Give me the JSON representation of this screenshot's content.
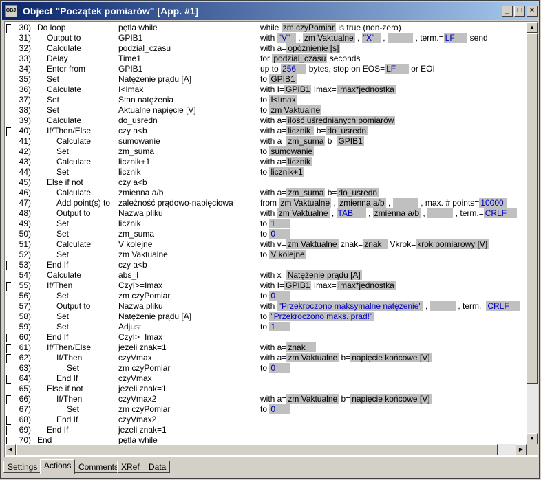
{
  "window": {
    "title": "Object \"Początek pomiarów\" [App. #1]",
    "icon_label": "OBJ",
    "buttons": {
      "minimize": "_",
      "maximize": "□",
      "close": "×"
    }
  },
  "tabs": [
    {
      "label": "Settings",
      "active": false
    },
    {
      "label": "Actions",
      "active": true
    },
    {
      "label": "Comments",
      "active": false
    },
    {
      "label": "XRef",
      "active": false
    },
    {
      "label": "Data",
      "active": false
    }
  ],
  "rows": [
    {
      "n": "30)",
      "ind": 0,
      "cmd": "Do loop",
      "arg": "pętla while",
      "br": "open",
      "p": [
        [
          "t",
          "while "
        ],
        [
          "h",
          "zm czyPomiar"
        ],
        [
          "t",
          " is true (non-zero)"
        ]
      ]
    },
    {
      "n": "31)",
      "ind": 1,
      "cmd": "Output to",
      "arg": "GPIB1",
      "p": [
        [
          "t",
          "with "
        ],
        [
          "b",
          "\"V\"  "
        ],
        [
          "t",
          " , "
        ],
        [
          "h",
          "zm Vaktualne"
        ],
        [
          "t",
          " , "
        ],
        [
          "b",
          "\"X\"  "
        ],
        [
          "t",
          " , "
        ],
        [
          "h",
          "          "
        ],
        [
          "t",
          " , term.="
        ],
        [
          "b",
          "LF     "
        ],
        [
          "t",
          " send"
        ]
      ]
    },
    {
      "n": "32)",
      "ind": 1,
      "cmd": "Calculate",
      "arg": "podzial_czasu",
      "p": [
        [
          "t",
          "with a="
        ],
        [
          "h",
          "opóźnienie [s]"
        ]
      ]
    },
    {
      "n": "33)",
      "ind": 1,
      "cmd": "Delay",
      "arg": "Time1",
      "p": [
        [
          "t",
          "for "
        ],
        [
          "h",
          "podzial_czasu"
        ],
        [
          "t",
          " seconds"
        ]
      ]
    },
    {
      "n": "34)",
      "ind": 1,
      "cmd": "Enter from",
      "arg": "GPIB1",
      "p": [
        [
          "t",
          "up to "
        ],
        [
          "b",
          "256    "
        ],
        [
          "t",
          " bytes, stop on EOS="
        ],
        [
          "b",
          "LF     "
        ],
        [
          "t",
          " or EOI"
        ]
      ]
    },
    {
      "n": "35)",
      "ind": 1,
      "cmd": "Set",
      "arg": "Natężenie prądu [A]",
      "p": [
        [
          "t",
          "to "
        ],
        [
          "h",
          "GPIB1"
        ]
      ]
    },
    {
      "n": "36)",
      "ind": 1,
      "cmd": "Calculate",
      "arg": "I<Imax",
      "p": [
        [
          "t",
          "with I="
        ],
        [
          "h",
          "GPIB1"
        ],
        [
          "t",
          " Imax="
        ],
        [
          "h",
          "Imax*jednostka"
        ]
      ]
    },
    {
      "n": "37)",
      "ind": 1,
      "cmd": "Set",
      "arg": "Stan natężenia",
      "p": [
        [
          "t",
          "to "
        ],
        [
          "h",
          "I<Imax"
        ]
      ]
    },
    {
      "n": "38)",
      "ind": 1,
      "cmd": "Set",
      "arg": "Aktualne napięcie [V]",
      "p": [
        [
          "t",
          "to "
        ],
        [
          "h",
          "zm Vaktualne"
        ]
      ]
    },
    {
      "n": "39)",
      "ind": 1,
      "cmd": "Calculate",
      "arg": "do_usredn",
      "p": [
        [
          "t",
          "with a="
        ],
        [
          "h",
          "ilość uśrednianych pomiarów"
        ]
      ]
    },
    {
      "n": "40)",
      "ind": 1,
      "cmd": "If/Then/Else",
      "arg": "czy a<b",
      "br": "open",
      "p": [
        [
          "t",
          "with a="
        ],
        [
          "h",
          "licznik "
        ],
        [
          "t",
          " b="
        ],
        [
          "h",
          "do_usredn"
        ]
      ]
    },
    {
      "n": "41)",
      "ind": 2,
      "cmd": "Calculate",
      "arg": "sumowanie",
      "p": [
        [
          "t",
          "with a="
        ],
        [
          "h",
          "zm_suma"
        ],
        [
          "t",
          " b="
        ],
        [
          "h",
          "GPIB1"
        ]
      ]
    },
    {
      "n": "42)",
      "ind": 2,
      "cmd": "Set",
      "arg": "zm_suma",
      "p": [
        [
          "t",
          "to "
        ],
        [
          "h",
          "sumowanie"
        ]
      ]
    },
    {
      "n": "43)",
      "ind": 2,
      "cmd": "Calculate",
      "arg": "licznik+1",
      "p": [
        [
          "t",
          "with a="
        ],
        [
          "h",
          "licznik"
        ]
      ]
    },
    {
      "n": "44)",
      "ind": 2,
      "cmd": "Set",
      "arg": "licznik",
      "p": [
        [
          "t",
          "to "
        ],
        [
          "h",
          "licznik+1"
        ]
      ]
    },
    {
      "n": "45)",
      "ind": 1,
      "cmd": "Else if not",
      "arg": "czy a<b",
      "p": []
    },
    {
      "n": "46)",
      "ind": 2,
      "cmd": "Calculate",
      "arg": "zmienna a/b",
      "p": [
        [
          "t",
          "with a="
        ],
        [
          "h",
          "zm_suma"
        ],
        [
          "t",
          " b="
        ],
        [
          "h",
          "do_usredn"
        ]
      ]
    },
    {
      "n": "47)",
      "ind": 2,
      "cmd": "Add point(s) to",
      "arg": "zależność prądowo-napięciowa",
      "p": [
        [
          "t",
          "from "
        ],
        [
          "h",
          "zm Vaktualne"
        ],
        [
          "t",
          " , "
        ],
        [
          "h",
          "zmienna a/b"
        ],
        [
          "t",
          " , "
        ],
        [
          "h",
          "          "
        ],
        [
          "t",
          " , max. # points="
        ],
        [
          "b",
          "10000 "
        ]
      ]
    },
    {
      "n": "48)",
      "ind": 2,
      "cmd": "Output to",
      "arg": "Nazwa pliku",
      "p": [
        [
          "t",
          "with "
        ],
        [
          "h",
          "zm Vaktualne"
        ],
        [
          "t",
          " , "
        ],
        [
          "b",
          "TAB     "
        ],
        [
          "t",
          " , "
        ],
        [
          "h",
          "zmienna a/b"
        ],
        [
          "t",
          " , "
        ],
        [
          "h",
          "          "
        ],
        [
          "t",
          " , term.="
        ],
        [
          "b",
          "CRLF    "
        ]
      ]
    },
    {
      "n": "49)",
      "ind": 2,
      "cmd": "Set",
      "arg": "licznik",
      "p": [
        [
          "t",
          "to "
        ],
        [
          "b",
          "1      "
        ]
      ]
    },
    {
      "n": "50)",
      "ind": 2,
      "cmd": "Set",
      "arg": "zm_suma",
      "p": [
        [
          "t",
          "to "
        ],
        [
          "b",
          "0      "
        ]
      ]
    },
    {
      "n": "51)",
      "ind": 2,
      "cmd": "Calculate",
      "arg": "V kolejne",
      "p": [
        [
          "t",
          "with v="
        ],
        [
          "h",
          "zm Vaktualne"
        ],
        [
          "t",
          " znak="
        ],
        [
          "h",
          "znak  "
        ],
        [
          "t",
          " Vkrok="
        ],
        [
          "h",
          "krok pomiarowy [V]"
        ]
      ]
    },
    {
      "n": "52)",
      "ind": 2,
      "cmd": "Set",
      "arg": "zm Vaktualne",
      "p": [
        [
          "t",
          "to "
        ],
        [
          "h",
          "V kolejne"
        ]
      ]
    },
    {
      "n": "53)",
      "ind": 1,
      "cmd": "End If",
      "arg": "czy a<b",
      "br": "close",
      "p": []
    },
    {
      "n": "54)",
      "ind": 1,
      "cmd": "Calculate",
      "arg": "abs_I",
      "p": [
        [
          "t",
          "with x="
        ],
        [
          "h",
          "Natężenie prądu [A]"
        ]
      ]
    },
    {
      "n": "55)",
      "ind": 1,
      "cmd": "If/Then",
      "arg": "CzyI>=Imax",
      "br": "open",
      "p": [
        [
          "t",
          "with I="
        ],
        [
          "h",
          "GPIB1"
        ],
        [
          "t",
          " Imax="
        ],
        [
          "h",
          "Imax*jednostka"
        ]
      ]
    },
    {
      "n": "56)",
      "ind": 2,
      "cmd": "Set",
      "arg": "zm czyPomiar",
      "p": [
        [
          "t",
          "to "
        ],
        [
          "b",
          "0      "
        ]
      ]
    },
    {
      "n": "57)",
      "ind": 2,
      "cmd": "Output to",
      "arg": "Nazwa pliku",
      "p": [
        [
          "t",
          "with "
        ],
        [
          "b",
          "\"Przekroczono maksymalne natężenie\""
        ],
        [
          "t",
          " , "
        ],
        [
          "h",
          "          "
        ],
        [
          "t",
          " , term.="
        ],
        [
          "b",
          "CRLF    "
        ]
      ]
    },
    {
      "n": "58)",
      "ind": 2,
      "cmd": "Set",
      "arg": "Natężenie prądu [A]",
      "p": [
        [
          "t",
          "to "
        ],
        [
          "b",
          "\"Przekroczono maks. prad!\""
        ]
      ]
    },
    {
      "n": "59)",
      "ind": 2,
      "cmd": "Set",
      "arg": "Adjust",
      "p": [
        [
          "t",
          "to "
        ],
        [
          "b",
          "1      "
        ]
      ]
    },
    {
      "n": "60)",
      "ind": 1,
      "cmd": "End If",
      "arg": "CzyI>=Imax",
      "br": "close",
      "p": []
    },
    {
      "n": "61)",
      "ind": 1,
      "cmd": "If/Then/Else",
      "arg": "jezeli znak=1",
      "br": "open",
      "p": [
        [
          "t",
          "with a="
        ],
        [
          "h",
          "znak    "
        ]
      ]
    },
    {
      "n": "62)",
      "ind": 2,
      "cmd": "If/Then",
      "arg": "czyVmax",
      "br": "open",
      "p": [
        [
          "t",
          "with a="
        ],
        [
          "h",
          "zm Vaktualne"
        ],
        [
          "t",
          " b="
        ],
        [
          "h",
          "napięcie końcowe [V]"
        ]
      ]
    },
    {
      "n": "63)",
      "ind": 3,
      "cmd": "Set",
      "arg": "zm czyPomiar",
      "p": [
        [
          "t",
          "to "
        ],
        [
          "b",
          "0      "
        ]
      ]
    },
    {
      "n": "64)",
      "ind": 2,
      "cmd": "End If",
      "arg": "czyVmax",
      "br": "close",
      "p": []
    },
    {
      "n": "65)",
      "ind": 1,
      "cmd": "Else if not",
      "arg": "jezeli znak=1",
      "p": []
    },
    {
      "n": "66)",
      "ind": 2,
      "cmd": "If/Then",
      "arg": "czyVmax2",
      "br": "open",
      "p": [
        [
          "t",
          "with a="
        ],
        [
          "h",
          "zm Vaktualne"
        ],
        [
          "t",
          " b="
        ],
        [
          "h",
          "napięcie końcowe [V]"
        ]
      ]
    },
    {
      "n": "67)",
      "ind": 3,
      "cmd": "Set",
      "arg": "zm czyPomiar",
      "p": [
        [
          "t",
          "to "
        ],
        [
          "b",
          "0      "
        ]
      ]
    },
    {
      "n": "68)",
      "ind": 2,
      "cmd": "End If",
      "arg": "czyVmax2",
      "br": "close",
      "p": []
    },
    {
      "n": "69)",
      "ind": 1,
      "cmd": "End If",
      "arg": "jezeli znak=1",
      "br": "close",
      "p": []
    },
    {
      "n": "70)",
      "ind": 0,
      "cmd": "End",
      "arg": "pętla while",
      "br": "close",
      "p": []
    }
  ]
}
